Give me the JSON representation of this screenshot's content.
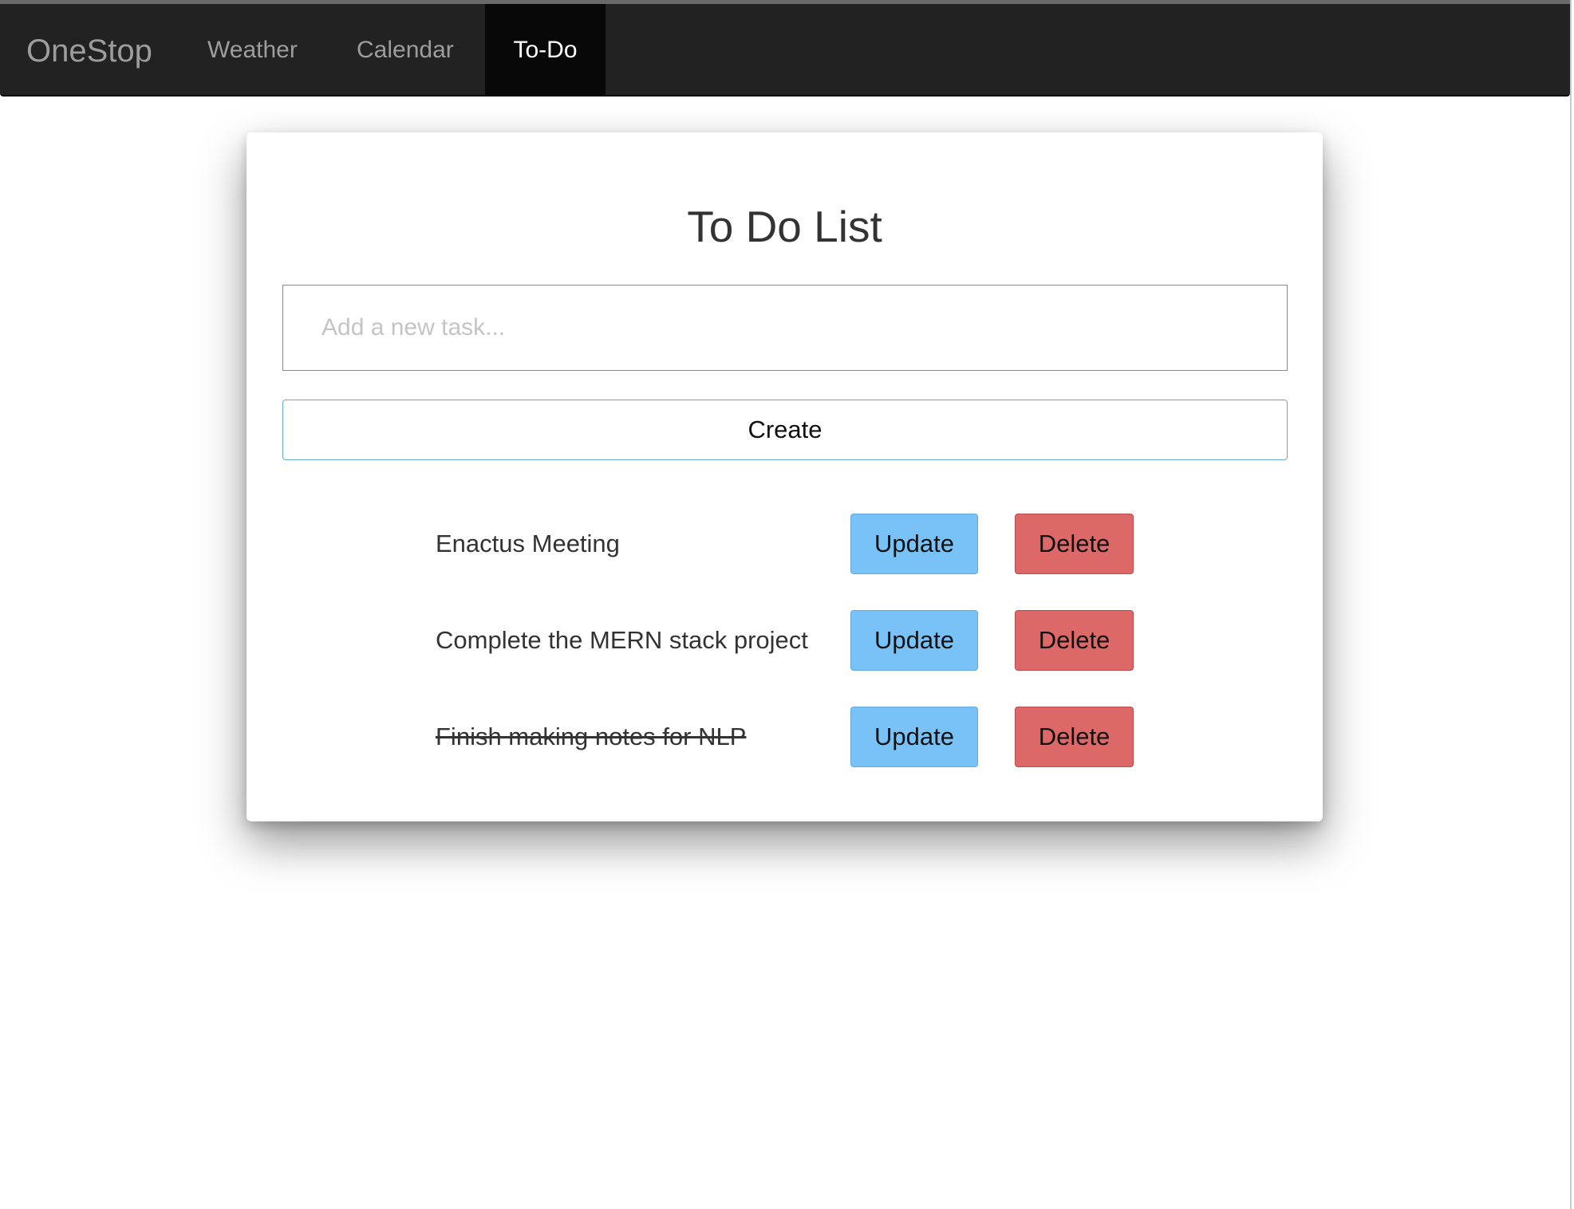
{
  "navbar": {
    "brand": "OneStop",
    "items": [
      {
        "label": "Weather",
        "active": false
      },
      {
        "label": "Calendar",
        "active": false
      },
      {
        "label": "To-Do",
        "active": true
      }
    ]
  },
  "main": {
    "title": "To Do List",
    "input": {
      "placeholder": "Add a new task...",
      "value": ""
    },
    "create_label": "Create",
    "tasks": [
      {
        "text": "Enactus Meeting",
        "completed": false,
        "update_label": "Update",
        "delete_label": "Delete"
      },
      {
        "text": "Complete the MERN stack project",
        "completed": false,
        "update_label": "Update",
        "delete_label": "Delete"
      },
      {
        "text": "Finish making notes for NLP",
        "completed": true,
        "update_label": "Update",
        "delete_label": "Delete"
      }
    ]
  },
  "colors": {
    "navbar_bg": "#222222",
    "nav_active_bg": "#080808",
    "nav_text": "#9d9d9d",
    "nav_active_text": "#ffffff",
    "update_button": "#78c2f8",
    "delete_button": "#dc6868",
    "create_border": "#6aa9cc"
  }
}
